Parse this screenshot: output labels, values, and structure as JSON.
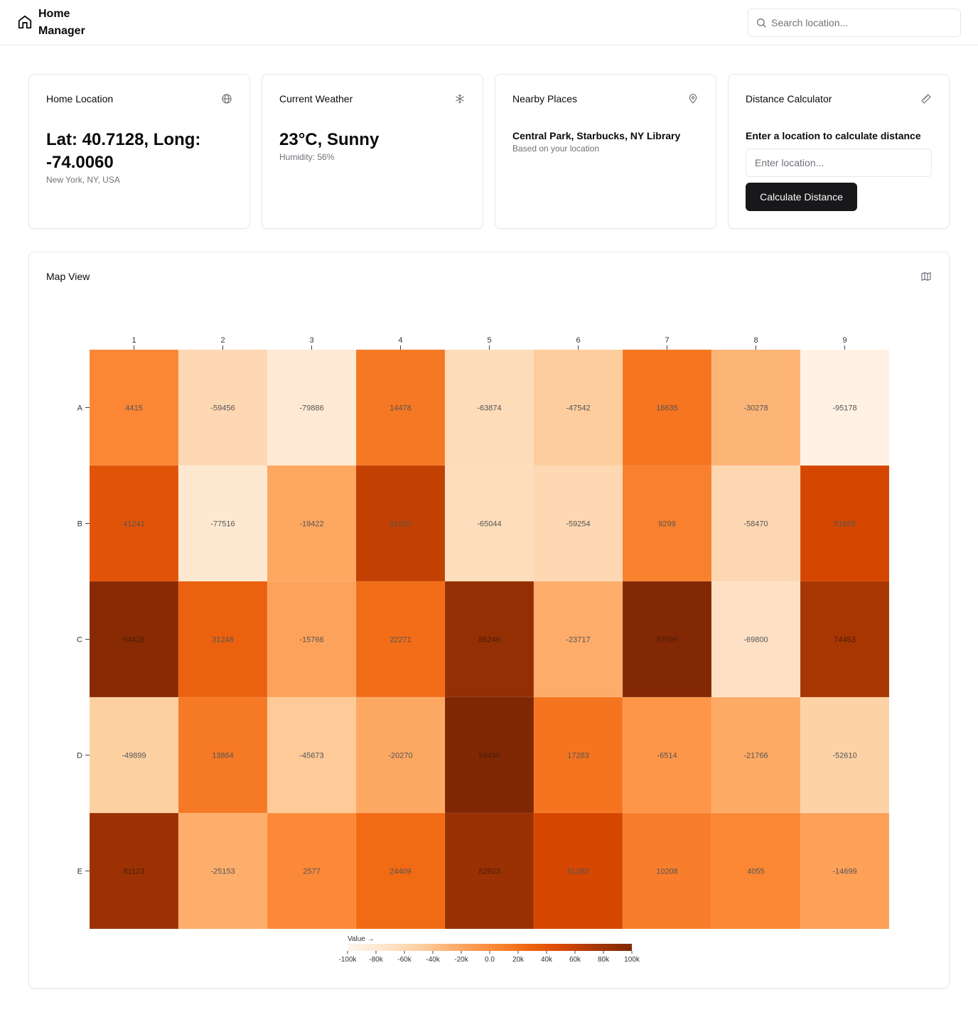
{
  "header": {
    "app_title": "Home Manager",
    "search_placeholder": "Search location..."
  },
  "cards": {
    "home_location": {
      "title": "Home Location",
      "coords": "Lat: 40.7128, Long: -74.0060",
      "place": "New York, NY, USA",
      "icon": "globe-icon"
    },
    "weather": {
      "title": "Current Weather",
      "summary": "23°C, Sunny",
      "humidity": "Humidity: 56%",
      "icon": "snowflake-icon"
    },
    "nearby": {
      "title": "Nearby Places",
      "places": "Central Park, Starbucks, NY Library",
      "note": "Based on your location",
      "icon": "map-pin-icon"
    },
    "distance": {
      "title": "Distance Calculator",
      "prompt": "Enter a location to calculate distance",
      "input_placeholder": "Enter location...",
      "button_label": "Calculate Distance",
      "icon": "ruler-icon"
    }
  },
  "map_view": {
    "title": "Map View",
    "icon": "map-icon"
  },
  "chart_data": {
    "type": "heatmap",
    "columns": [
      "1",
      "2",
      "3",
      "4",
      "5",
      "6",
      "7",
      "8",
      "9"
    ],
    "rows": [
      "A",
      "B",
      "C",
      "D",
      "E"
    ],
    "values": [
      [
        4415,
        -59456,
        -79886,
        14478,
        -63874,
        -47542,
        16635,
        -30278,
        -95178
      ],
      [
        41241,
        -77516,
        -19422,
        61220,
        -65044,
        -59254,
        9299,
        -58470,
        51828
      ],
      [
        94426,
        31248,
        -15766,
        22271,
        86246,
        -23717,
        97595,
        -69800,
        74453
      ],
      [
        -49899,
        13864,
        -45673,
        -20270,
        99430,
        17283,
        -6514,
        -21766,
        -52610
      ],
      [
        81123,
        -25153,
        2577,
        24409,
        82923,
        51283,
        10208,
        4055,
        -14699
      ]
    ],
    "color_scale": "Oranges",
    "domain": [
      -100000,
      100000
    ],
    "legend": {
      "title": "Value →",
      "ticks": [
        "-100k",
        "-80k",
        "-60k",
        "-40k",
        "-20k",
        "0.0",
        "20k",
        "40k",
        "60k",
        "80k",
        "100k"
      ],
      "placement": "bottom-center"
    }
  }
}
